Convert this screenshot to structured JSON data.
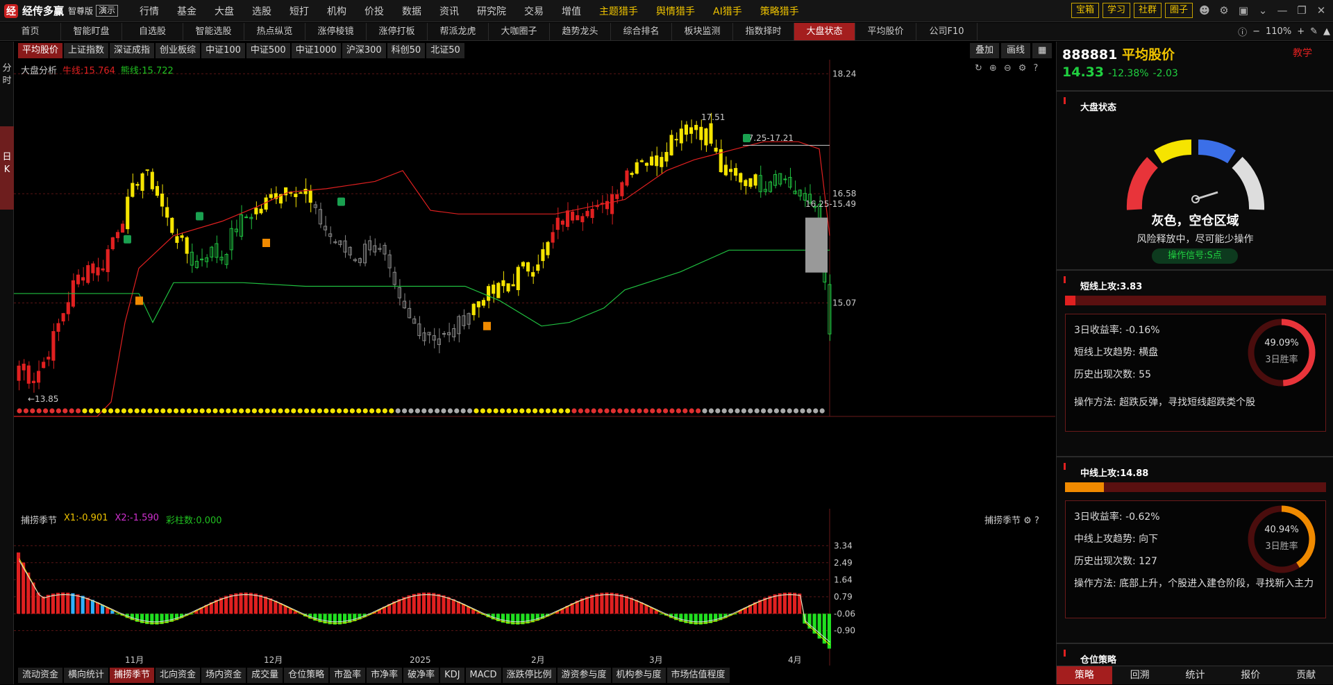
{
  "topbar": {
    "logo_mark": "经",
    "app_name": "经传多赢",
    "edition": "智尊版",
    "demo": "演示",
    "menu": [
      {
        "label": "行情"
      },
      {
        "label": "基金"
      },
      {
        "label": "大盘"
      },
      {
        "label": "选股"
      },
      {
        "label": "短打"
      },
      {
        "label": "机构"
      },
      {
        "label": "价投"
      },
      {
        "label": "数据"
      },
      {
        "label": "资讯"
      },
      {
        "label": "研究院"
      },
      {
        "label": "交易"
      },
      {
        "label": "增值"
      },
      {
        "label": "主题猎手"
      },
      {
        "label": "舆情猎手"
      },
      {
        "label": "AI猎手"
      },
      {
        "label": "策略猎手"
      }
    ],
    "right_buttons": [
      "宝箱",
      "学习",
      "社群",
      "圈子"
    ]
  },
  "tabs": [
    "首页",
    "智能盯盘",
    "自选股",
    "智能选股",
    "热点纵览",
    "涨停棱镜",
    "涨停打板",
    "帮派龙虎",
    "大咖圈子",
    "趋势龙头",
    "综合排名",
    "板块监测",
    "指数择时",
    "大盘状态",
    "平均股价",
    "公司F10"
  ],
  "active_tab": "大盘状态",
  "zoom": "110%",
  "left_strip": {
    "top": "分 时",
    "mid": "日 K"
  },
  "subtabs": [
    "平均股价",
    "上证指数",
    "深证成指",
    "创业板综",
    "中证100",
    "中证500",
    "中证1000",
    "沪深300",
    "科创50",
    "北证50"
  ],
  "overlay_btns": [
    "叠加",
    "画线"
  ],
  "chart_header": {
    "name": "大盘分析",
    "bull": "牛线:15.764",
    "bear": "熊线:15.722"
  },
  "chart_data": {
    "type": "candlestick",
    "ylim": [
      13.5,
      18.3
    ],
    "y_ticks": [
      18.24,
      16.58,
      15.07
    ],
    "x_labels": [
      "11月",
      "12月",
      "2025",
      "2月",
      "3月",
      "4月"
    ],
    "annotations": [
      "←13.85",
      "17.51",
      "17.25-17.21",
      "16.25-15.49"
    ],
    "sub": {
      "title": "捕捞季节",
      "x1": "X1:-0.901",
      "x2": "X2:-1.590",
      "bars": "彩柱数:0.000",
      "y_ticks": [
        3.34,
        2.49,
        1.64,
        0.79,
        -0.06,
        -0.9
      ]
    }
  },
  "subchart_label": "捕捞季节",
  "bottom_tabs": [
    "流动资金",
    "横向统计",
    "捕捞季节",
    "北向资金",
    "场内资金",
    "成交量",
    "仓位策略",
    "市盈率",
    "市净率",
    "破净率",
    "KDJ",
    "MACD",
    "涨跌停比例",
    "游资参与度",
    "机构参与度",
    "市场估值程度"
  ],
  "right_panel": {
    "code": "888881",
    "name": "平均股价",
    "teach": "教学",
    "price": "14.33",
    "change_pct": "-12.38%",
    "change": "-2.03",
    "market_state": {
      "title": "大盘状态",
      "status": "灰色，空仓区域",
      "desc": "风险释放中，尽可能少操作",
      "signal": "操作信号:S点"
    },
    "short": {
      "title": "短线上攻:3.83",
      "ret": "3日收益率:  -0.16%",
      "trend": "短线上攻趋势:  横盘",
      "count": "历史出现次数:  55",
      "method": "操作方法:  超跌反弹，寻找短线超跌类个股",
      "pct": "49.09%",
      "pct_label": "3日胜率",
      "level": 0.04
    },
    "mid": {
      "title": "中线上攻:14.88",
      "ret": "3日收益率:  -0.62%",
      "trend": "中线上攻趋势:  向下",
      "count": "历史出现次数:  127",
      "method": "操作方法:  底部上升，个股进入建仓阶段，寻找新入主力",
      "pct": "40.94%",
      "pct_label": "3日胜率",
      "level": 0.15
    },
    "position": {
      "title": "仓位策略"
    },
    "bottom_tabs": [
      "策略",
      "回溯",
      "统计",
      "报价",
      "贡献"
    ]
  }
}
